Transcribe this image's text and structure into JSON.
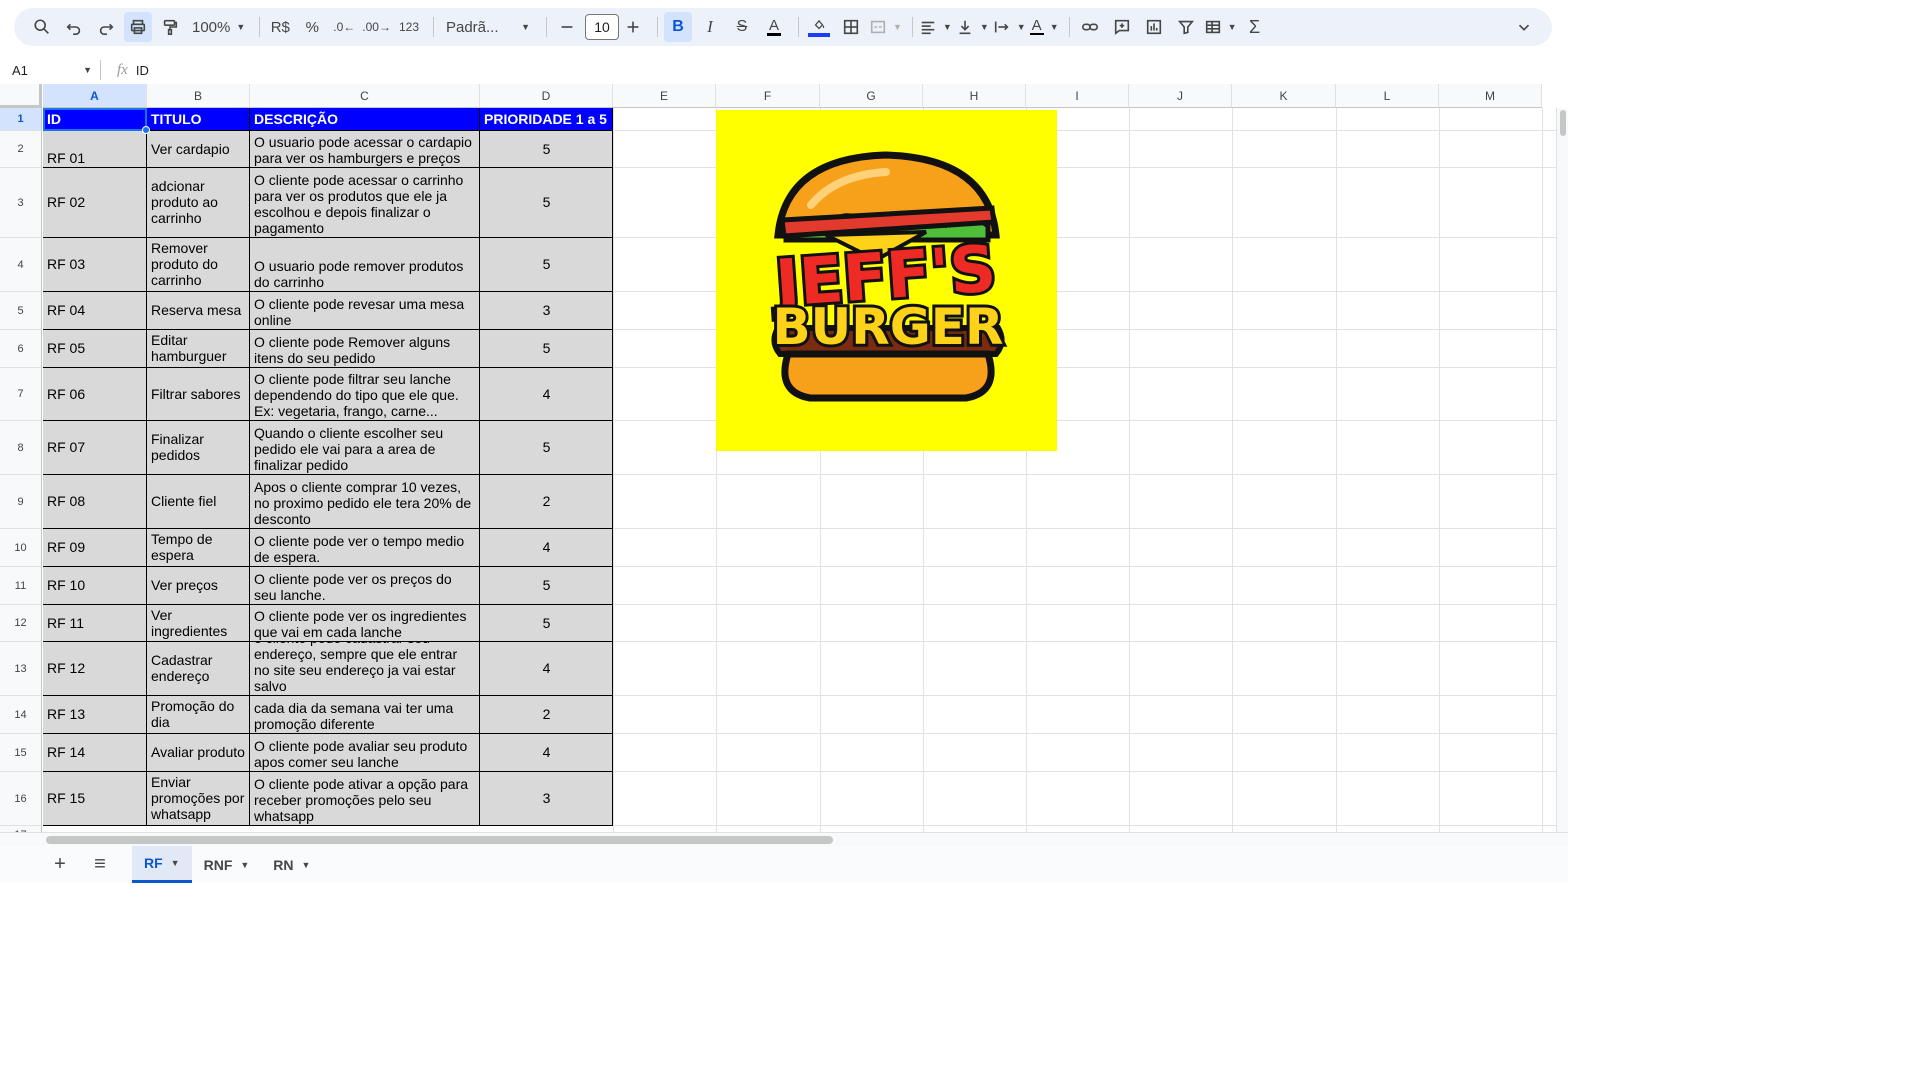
{
  "toolbar": {
    "zoom": "100%",
    "currency": "R$",
    "percent": "%",
    "decimal_decrease": ".0",
    "decimal_increase": ".00",
    "number_format": "123",
    "font_name": "Padrã...",
    "font_size": "10",
    "bold": "B",
    "italic": "I",
    "strike": "S",
    "text_color": "A",
    "text_rotation": "A",
    "icons": [
      "search-icon",
      "undo-icon",
      "redo-icon",
      "print-icon",
      "paint-format-icon",
      "minus-icon",
      "plus-icon",
      "fill-color-icon",
      "borders-icon",
      "merge-icon",
      "align-icon",
      "valign-icon",
      "wrap-icon",
      "link-icon",
      "comment-icon",
      "chart-icon",
      "filter-icon",
      "table-icon",
      "sigma-icon",
      "collapse-icon"
    ]
  },
  "formula_bar": {
    "cell_ref": "A1",
    "fx": "fx",
    "value": "ID"
  },
  "columns": [
    "A",
    "B",
    "C",
    "D",
    "E",
    "F",
    "G",
    "H",
    "I",
    "J",
    "K",
    "L",
    "M"
  ],
  "header": {
    "id": "ID",
    "titulo": "TITULO",
    "descricao": "DESCRIÇÃO",
    "prioridade": "PRIORIDADE 1 a 5"
  },
  "rows": [
    {
      "n": "2",
      "id": "RF 01",
      "titulo": "Ver cardapio",
      "descricao": "O usuario pode acessar o cardapio para ver os hamburgers e preços",
      "prioridade": "5"
    },
    {
      "n": "3",
      "id": "RF 02",
      "titulo": "adcionar produto ao carrinho",
      "descricao": "O cliente pode acessar o carrinho para ver os produtos que ele ja escolhou e depois finalizar o pagamento",
      "prioridade": "5"
    },
    {
      "n": "4",
      "id": "RF 03",
      "titulo": "Remover produto do carrinho",
      "descricao": "O usuario pode remover produtos do carrinho",
      "prioridade": "5"
    },
    {
      "n": "5",
      "id": "RF 04",
      "titulo": "Reserva mesa",
      "descricao": "O cliente pode revesar uma mesa online",
      "prioridade": "3"
    },
    {
      "n": "6",
      "id": "RF 05",
      "titulo": "Editar hamburguer",
      "descricao": "O cliente pode Remover alguns itens do seu pedido",
      "prioridade": "5"
    },
    {
      "n": "7",
      "id": "RF 06",
      "titulo": "Filtrar sabores",
      "descricao": "O cliente pode filtrar seu lanche dependendo do tipo que ele que. Ex: vegetaria, frango, carne...",
      "prioridade": "4"
    },
    {
      "n": "8",
      "id": "RF 07",
      "titulo": "Finalizar pedidos",
      "descricao": "Quando o cliente escolher seu pedido ele vai para a area de finalizar pedido",
      "prioridade": "5"
    },
    {
      "n": "9",
      "id": "RF 08",
      "titulo": "Cliente fiel",
      "descricao": "Apos o cliente comprar 10 vezes, no proximo pedido ele tera 20% de desconto",
      "prioridade": "2"
    },
    {
      "n": "10",
      "id": "RF 09",
      "titulo": "Tempo de espera",
      "descricao": "O cliente pode ver o tempo medio de espera.",
      "prioridade": "4"
    },
    {
      "n": "11",
      "id": "RF 10",
      "titulo": "Ver preços",
      "descricao": "O cliente pode ver os preços do seu lanche.",
      "prioridade": "5"
    },
    {
      "n": "12",
      "id": "RF 11",
      "titulo": "Ver ingredientes",
      "descricao": "O cliente pode ver os ingredientes que vai em cada lanche",
      "prioridade": "5"
    },
    {
      "n": "13",
      "id": "RF 12",
      "titulo": "Cadastrar endereço",
      "descricao": "o cliente pode cadastrar seu endereço, sempre que ele entrar no site seu endereço ja vai estar salvo",
      "prioridade": "4"
    },
    {
      "n": "14",
      "id": "RF 13",
      "titulo": "Promoção do dia",
      "descricao": "cada dia da semana vai ter uma promoção diferente",
      "prioridade": "2"
    },
    {
      "n": "15",
      "id": "RF 14",
      "titulo": "Avaliar produto",
      "descricao": "O cliente pode avaliar seu produto apos comer seu lanche",
      "prioridade": "4"
    },
    {
      "n": "16",
      "id": "RF 15",
      "titulo": "Enviar promoções por whatsapp",
      "descricao": "O cliente pode ativar a opção para receber promoções pelo seu whatsapp",
      "prioridade": "3"
    }
  ],
  "logo": {
    "line1": "JEFF'S",
    "line2": "BURGER",
    "background": "#ffff00"
  },
  "sheet_tabs": [
    {
      "label": "RF",
      "active": true
    },
    {
      "label": "RNF",
      "active": false
    },
    {
      "label": "RN",
      "active": false
    }
  ],
  "colors": {
    "header_bg": "#0000ff",
    "data_bg": "#d9d9d9",
    "selection": "#1a73e8"
  }
}
